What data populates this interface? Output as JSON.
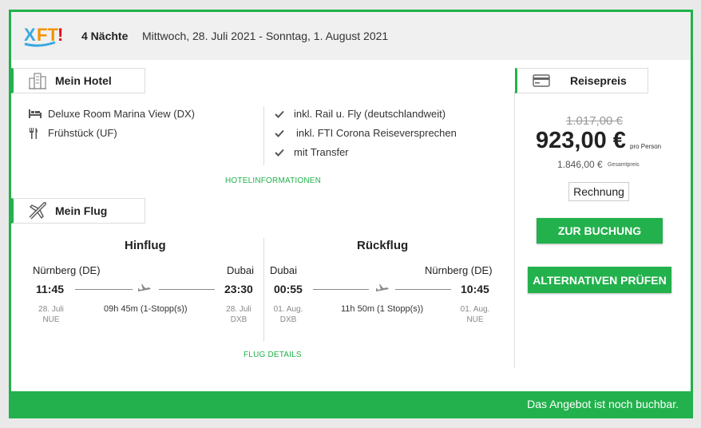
{
  "header": {
    "nights": "4 Nächte",
    "dates": "Mittwoch, 28. Juli 2021 - Sonntag, 1. August 2021"
  },
  "hotel": {
    "tab_label": "Mein Hotel",
    "room": "Deluxe Room Marina View (DX)",
    "board": "Frühstück (UF)",
    "features": [
      "inkl. Rail u. Fly (deutschlandweit)",
      "inkl. FTI Corona Reiseversprechen",
      "mit Transfer"
    ],
    "info_link": "HOTELINFORMATIONEN"
  },
  "flight": {
    "tab_label": "Mein Flug",
    "outbound": {
      "title": "Hinflug",
      "from_city": "Nürnberg (DE)",
      "to_city": "Dubai",
      "dep_time": "11:45",
      "arr_time": "23:30",
      "dep_date": "28. Juli",
      "dep_code": "NUE",
      "arr_date": "28. Juli",
      "arr_code": "DXB",
      "duration": "09h 45m (1-Stopp(s))"
    },
    "return": {
      "title": "Rückflug",
      "from_city": "Dubai",
      "to_city": "Nürnberg (DE)",
      "dep_time": "00:55",
      "arr_time": "10:45",
      "dep_date": "01. Aug.",
      "dep_code": "DXB",
      "arr_date": "01. Aug.",
      "arr_code": "NUE",
      "duration": "11h 50m (1 Stopp(s))"
    },
    "details_link": "FLUG DETAILS"
  },
  "price": {
    "tab_label": "Reisepreis",
    "old_price": "1.017,00 €",
    "price": "923,00 €",
    "per_person_label": "pro Person",
    "total": "1.846,00 €",
    "total_label": "Gesamtpreis",
    "invoice_button": "Rechnung",
    "book_button": "ZUR BUCHUNG",
    "alternatives_button": "ALTERNATIVEN PRÜFEN"
  },
  "footer": {
    "status": "Das Angebot ist noch buchbar."
  },
  "colors": {
    "accent": "#22b14c",
    "header_bg": "#f0f0f0"
  },
  "icons": [
    "xfti-logo",
    "hotel-building-icon",
    "bed-icon",
    "cutlery-icon",
    "check-icon",
    "airplane-icon",
    "credit-card-icon"
  ]
}
